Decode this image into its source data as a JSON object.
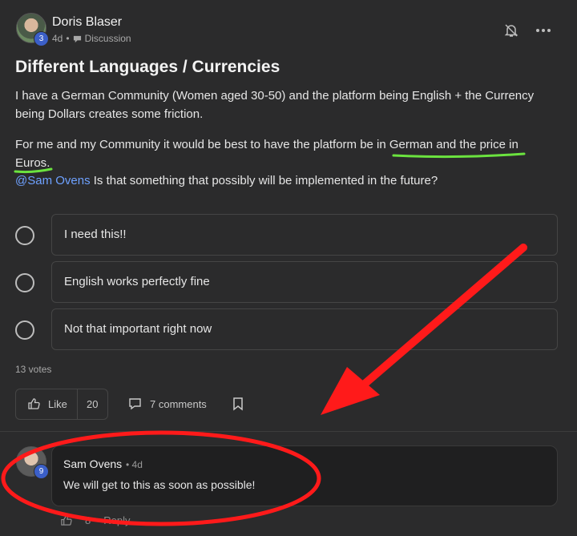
{
  "post": {
    "author": "Doris Blaser",
    "level": "3",
    "time": "4d",
    "category": "Discussion",
    "title": "Different Languages / Currencies",
    "para1": "I have a German Community (Women aged 30-50) and the platform being English + the Currency being Dollars creates some friction.",
    "para2_before": "For me and my Community it would be best to have the platform be in ",
    "para2_highlight": "German and the price in Euros",
    "para2_after": ".",
    "mention": "@Sam Ovens",
    "para3": " Is that something that possibly will be implemented in the future?"
  },
  "poll": {
    "options": [
      "I need this!!",
      "English works perfectly fine",
      "Not that important right now"
    ],
    "votes": "13 votes"
  },
  "actions": {
    "like_label": "Like",
    "like_count": "20",
    "comments_label": "7 comments"
  },
  "comment": {
    "author": "Sam Ovens",
    "time": "• 4d",
    "level": "9",
    "text": "We will get to this as soon as possible!",
    "like_count": "8",
    "reply_label": "Reply"
  },
  "colors": {
    "background": "#2b2b2c",
    "mention": "#6ea1ff",
    "annotation_red": "#ff1a1a",
    "highlight_green": "#6be33f"
  }
}
